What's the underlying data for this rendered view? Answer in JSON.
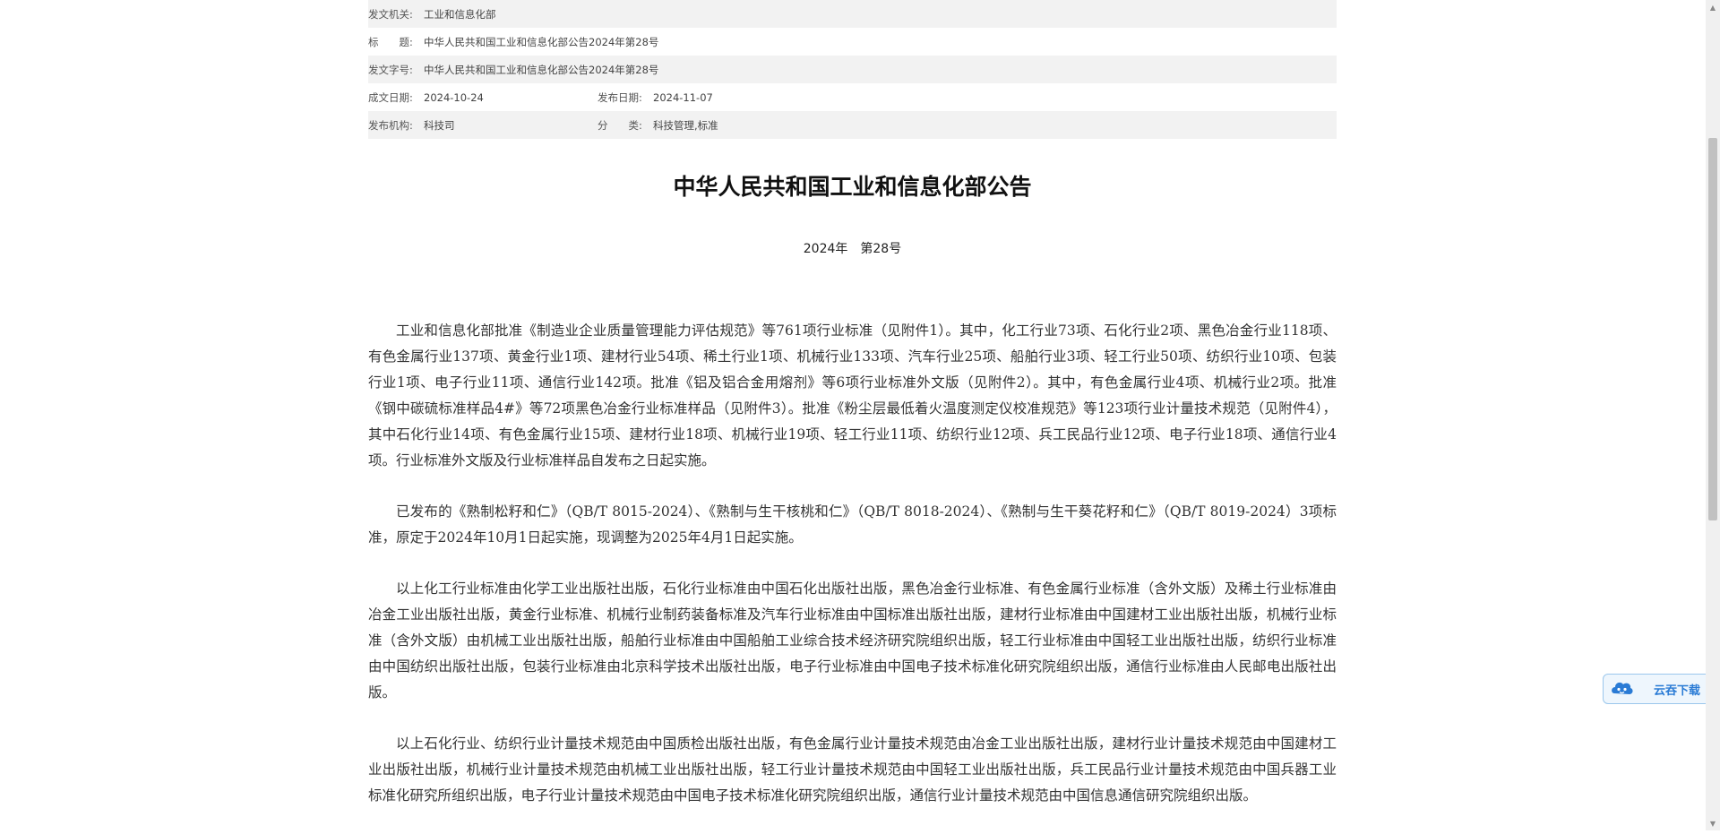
{
  "meta": {
    "rows": [
      {
        "label": "发文机关:",
        "value": "工业和信息化部"
      },
      {
        "label": "标　　题:",
        "value": "中华人民共和国工业和信息化部公告2024年第28号"
      },
      {
        "label": "发文字号:",
        "value": "中华人民共和国工业和信息化部公告2024年第28号"
      }
    ],
    "row4": {
      "left_label": "成文日期:",
      "left_value": "2024-10-24",
      "right_label": "发布日期:",
      "right_value": "2024-11-07"
    },
    "row5": {
      "left_label": "发布机构:",
      "left_value": "科技司",
      "right_label": "分　　类:",
      "right_value": "科技管理,标准"
    }
  },
  "document": {
    "title": "中华人民共和国工业和信息化部公告",
    "number": "2024年　第28号",
    "paragraphs": [
      "工业和信息化部批准《制造业企业质量管理能力评估规范》等761项行业标准（见附件1）。其中，化工行业73项、石化行业2项、黑色冶金行业118项、有色金属行业137项、黄金行业1项、建材行业54项、稀土行业1项、机械行业133项、汽车行业25项、船舶行业3项、轻工行业50项、纺织行业10项、包装行业1项、电子行业11项、通信行业142项。批准《铝及铝合金用熔剂》等6项行业标准外文版（见附件2）。其中，有色金属行业4项、机械行业2项。批准《钢中碳硫标准样品4#》等72项黑色冶金行业标准样品（见附件3）。批准《粉尘层最低着火温度测定仪校准规范》等123项行业计量技术规范（见附件4），其中石化行业14项、有色金属行业15项、建材行业18项、机械行业19项、轻工行业11项、纺织行业12项、兵工民品行业12项、电子行业18项、通信行业4项。行业标准外文版及行业标准样品自发布之日起实施。",
      "已发布的《熟制松籽和仁》（QB/T 8015-2024）、《熟制与生干核桃和仁》（QB/T 8018-2024）、《熟制与生干葵花籽和仁》（QB/T 8019-2024）3项标准，原定于2024年10月1日起实施，现调整为2025年4月1日起实施。",
      "以上化工行业标准由化学工业出版社出版，石化行业标准由中国石化出版社出版，黑色冶金行业标准、有色金属行业标准（含外文版）及稀土行业标准由冶金工业出版社出版，黄金行业标准、机械行业制药装备标准及汽车行业标准由中国标准出版社出版，建材行业标准由中国建材工业出版社出版，机械行业标准（含外文版）由机械工业出版社出版，船舶行业标准由中国船舶工业综合技术经济研究院组织出版，轻工行业标准由中国轻工业出版社出版，纺织行业标准由中国纺织出版社出版，包装行业标准由北京科学技术出版社出版，电子行业标准由中国电子技术标准化研究院组织出版，通信行业标准由人民邮电出版社出版。",
      "以上石化行业、纺织行业计量技术规范由中国质检出版社出版，有色金属行业计量技术规范由冶金工业出版社出版，建材行业计量技术规范由中国建材工业出版社出版，机械行业计量技术规范由机械工业出版社出版，轻工行业计量技术规范由中国轻工业出版社出版，兵工民品行业计量技术规范由中国兵器工业标准化研究所组织出版，电子行业计量技术规范由中国电子技术标准化研究院组织出版，通信行业计量技术规范由中国信息通信研究院组织出版。"
    ]
  },
  "widget": {
    "download_label": "云吞下载",
    "icon": "cloud-mascot-icon",
    "accent": "#2a7bd5"
  },
  "scrollbar": {
    "up_icon": "▲",
    "down_icon": "▼"
  }
}
